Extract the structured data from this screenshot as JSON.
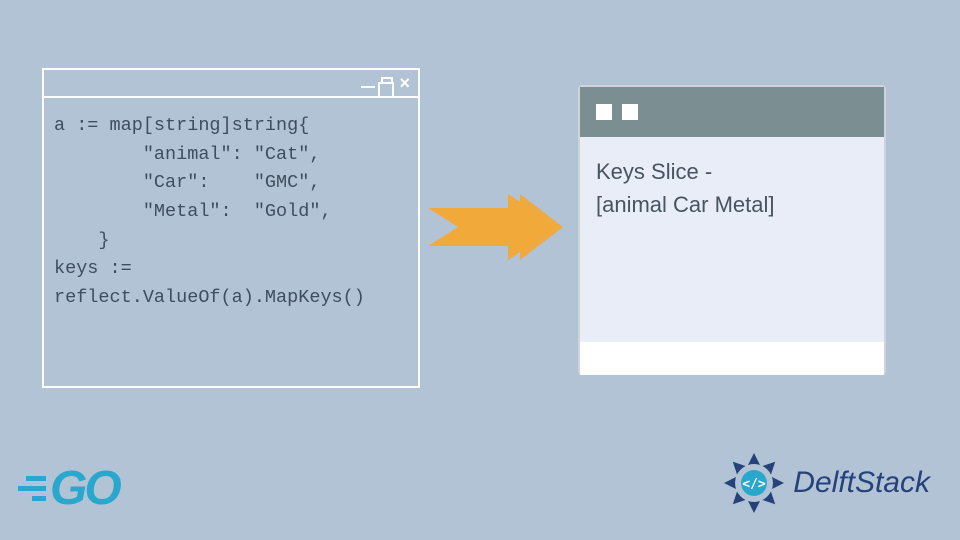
{
  "code": {
    "line1": "a := map[string]string{",
    "line2": "        \"animal\": \"Cat\",",
    "line3": "        \"Car\":    \"GMC\",",
    "line4": "        \"Metal\":  \"Gold\",",
    "line5": "    }",
    "line6": "keys :=",
    "line7": "reflect.ValueOf(a).MapKeys()"
  },
  "output": {
    "line1": "Keys Slice -",
    "line2": "[animal Car Metal]"
  },
  "logos": {
    "go": "GO",
    "delft": "DelftStack"
  },
  "colors": {
    "bg": "#b2c3d6",
    "arrow": "#f0a93a",
    "outputHeader": "#7b8f92",
    "outputBody": "#e8edf7",
    "goBlue": "#2aa7cc",
    "delftBlue": "#25427a"
  }
}
